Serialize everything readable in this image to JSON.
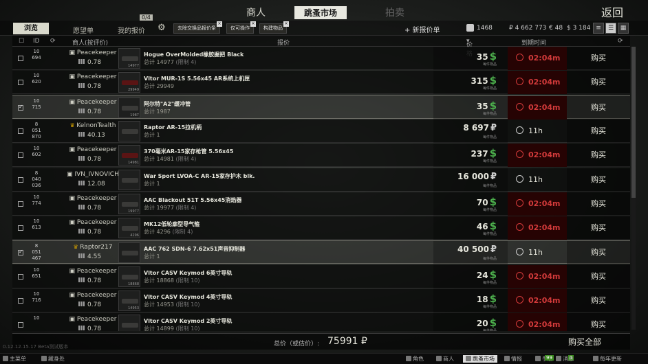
{
  "nav": {
    "tabs": [
      {
        "label": "商人"
      },
      {
        "label": "跳蚤市场"
      },
      {
        "label": "拍卖"
      }
    ],
    "back_label": "返回"
  },
  "toolbar": {
    "browse_label": "浏览",
    "wishlist_label": "愿望单",
    "my_offers_label": "我的报价",
    "offer_count": "0/4",
    "filters": [
      "去除交换品报价条",
      "仅可操作",
      "构建物品"
    ],
    "new_offer_label": "+ 新报价单",
    "rating_value": "1468",
    "roubles": "₽ 4 662 773",
    "euros": "€ 48",
    "dollars": "$ 3 184"
  },
  "columns": {
    "id": "ID",
    "merchant": "商人(按评价)",
    "offer": "报价",
    "price": "价格",
    "expires": "到期时间"
  },
  "rows": [
    {
      "id": "10\n694",
      "seller": "Peacekeeper",
      "crown": false,
      "rating": "0.78",
      "name": "Hogue OverMolded橡胶握把 Black",
      "total": "总计 14977",
      "limit": "(限制 4)",
      "thumb_num": "14977",
      "red": false,
      "price": "35",
      "currency": "usd",
      "each": "每件物品",
      "time": "02:04m",
      "expired": true,
      "selected": false,
      "buy": "购买"
    },
    {
      "id": "10\n620",
      "seller": "Peacekeeper",
      "crown": false,
      "rating": "0.78",
      "name": "Vltor MUR-1S 5.56x45 AR系统上机匣",
      "total": "总计 29949",
      "limit": "",
      "thumb_num": "29949",
      "red": true,
      "price": "315",
      "currency": "usd",
      "each": "每件物品",
      "time": "02:04m",
      "expired": true,
      "selected": false,
      "buy": "购买"
    },
    {
      "id": "10\n715",
      "seller": "Peacekeeper",
      "crown": false,
      "rating": "0.78",
      "name": "阿尔特\"A2\"缓冲管",
      "total": "总计 1987",
      "limit": "",
      "thumb_num": "1987",
      "red": false,
      "price": "35",
      "currency": "usd",
      "each": "每件物品",
      "time": "02:04m",
      "expired": true,
      "selected": true,
      "buy": "购买"
    },
    {
      "id": "8\n051\n870",
      "seller": "KelnonTealth",
      "crown": true,
      "rating": "40.13",
      "name": "Raptor AR-15拉机柄",
      "total": "总计 1",
      "limit": "",
      "thumb_num": "",
      "red": false,
      "price": "8 697",
      "currency": "rub",
      "each": "每件物品",
      "time": "11h",
      "expired": false,
      "selected": false,
      "buy": "购买"
    },
    {
      "id": "10\n602",
      "seller": "Peacekeeper",
      "crown": false,
      "rating": "0.78",
      "name": "370毫米AR-15家存枪管 5.56x45",
      "total": "总计 14981",
      "limit": "(限制 4)",
      "thumb_num": "14981",
      "red": true,
      "price": "237",
      "currency": "usd",
      "each": "每件物品",
      "time": "02:04m",
      "expired": true,
      "selected": false,
      "buy": "购买"
    },
    {
      "id": "8\n040\n036",
      "seller": "IVN_IVNOVICH",
      "crown": false,
      "rating": "12.08",
      "name": "War Sport LVOA-C AR-15家存护木 blk.",
      "total": "总计 1",
      "limit": "",
      "thumb_num": "",
      "red": false,
      "price": "16 000",
      "currency": "rub",
      "each": "每件物品",
      "time": "11h",
      "expired": false,
      "selected": false,
      "buy": "购买"
    },
    {
      "id": "10\n774",
      "seller": "Peacekeeper",
      "crown": false,
      "rating": "0.78",
      "name": "AAC Blackout 51T 5.56x45消焰器",
      "total": "总计 19977",
      "limit": "(限制 4)",
      "thumb_num": "19977",
      "red": false,
      "price": "70",
      "currency": "usd",
      "each": "每件物品",
      "time": "02:04m",
      "expired": true,
      "selected": false,
      "buy": "购买"
    },
    {
      "id": "10\n613",
      "seller": "Peacekeeper",
      "crown": false,
      "rating": "0.78",
      "name": "MK12低轮廓型导气箍",
      "total": "总计 4296",
      "limit": "(限制 4)",
      "thumb_num": "4296",
      "red": false,
      "price": "46",
      "currency": "usd",
      "each": "每件物品",
      "time": "02:04m",
      "expired": true,
      "selected": false,
      "buy": "购买"
    },
    {
      "id": "8\n051\n467",
      "seller": "Raptor217",
      "crown": true,
      "rating": "4.55",
      "name": "AAC 762 SDN-6 7.62x51声音抑制器",
      "total": "总计 1",
      "limit": "",
      "thumb_num": "",
      "red": false,
      "price": "40 500",
      "currency": "rub",
      "each": "每件物品",
      "time": "11h",
      "expired": false,
      "selected": true,
      "buy": "购买"
    },
    {
      "id": "10\n651",
      "seller": "Peacekeeper",
      "crown": false,
      "rating": "0.78",
      "name": "Vltor CASV Keymod 6英寸导轨",
      "total": "总计 18868",
      "limit": "(限制 10)",
      "thumb_num": "18868",
      "red": false,
      "price": "24",
      "currency": "usd",
      "each": "每件物品",
      "time": "02:04m",
      "expired": true,
      "selected": false,
      "buy": "购买"
    },
    {
      "id": "10\n716",
      "seller": "Peacekeeper",
      "crown": false,
      "rating": "0.78",
      "name": "Vltor CASV Keymod 4英寸导轨",
      "total": "总计 14953",
      "limit": "(限制 10)",
      "thumb_num": "14953",
      "red": false,
      "price": "18",
      "currency": "usd",
      "each": "每件物品",
      "time": "02:04m",
      "expired": true,
      "selected": false,
      "buy": "购买"
    },
    {
      "id": "10\n",
      "seller": "Peacekeeper",
      "crown": false,
      "rating": "0.78",
      "name": "Vltor CASV Keymod 2英寸导轨",
      "total": "总计 14899",
      "limit": "(限制 10)",
      "thumb_num": "",
      "red": false,
      "price": "20",
      "currency": "usd",
      "each": "每件物品",
      "time": "02:04m",
      "expired": true,
      "selected": false,
      "buy": "购买"
    }
  ],
  "footer": {
    "total_label": "总价（或估价）:",
    "total_value": "75991 ₽",
    "buy_all_label": "购买全部"
  },
  "beta_text": "0.12.12.15.17 Beta测试版本",
  "bottombar": {
    "left": [
      "主菜单",
      "藏身处"
    ],
    "right": [
      "角色",
      "商人",
      "跳蚤市场",
      "情报",
      "手册",
      "消息",
      "每年更新"
    ],
    "badge_a": "99",
    "badge_b": "1"
  },
  "colors": {
    "usd": "#4cae4c",
    "expired_bg": "#260303",
    "expired_text": "#d23a3a",
    "crown": "#d6a300"
  }
}
